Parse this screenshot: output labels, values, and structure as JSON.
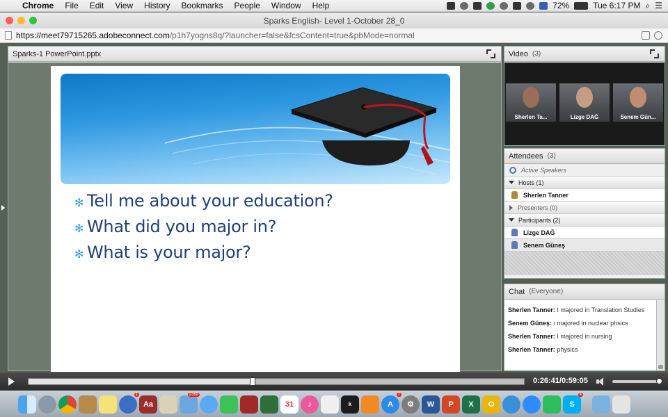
{
  "menubar": {
    "app": "Chrome",
    "items": [
      "File",
      "Edit",
      "View",
      "History",
      "Bookmarks",
      "People",
      "Window",
      "Help"
    ],
    "battery": "72%",
    "clock": "Tue 6:17 PM"
  },
  "browser": {
    "title": "Sparks English- Level 1-October 28_0",
    "url_host": "https://meet79715265.adobeconnect.com",
    "url_rest": "/p1h7yogns8q/?launcher=false&fcsContent=true&pbMode=normal"
  },
  "share": {
    "title": "Sparks-1 PowerPoint.pptx",
    "bullets": [
      "Tell me about your education?",
      "What did you major in?",
      "What is your major?"
    ]
  },
  "video": {
    "title": "Video",
    "count": "(3)",
    "feeds": [
      {
        "name": "Sherlen Ta..."
      },
      {
        "name": "Lizge DAĞ"
      },
      {
        "name": "Senem Gün..."
      }
    ]
  },
  "attendees": {
    "title": "Attendees",
    "count": "(3)",
    "active_speakers": "Active Speakers",
    "hosts_label": "Hosts (1)",
    "hosts": [
      "Sherlen Tanner"
    ],
    "presenters_label": "Presenters (0)",
    "participants_label": "Participants (2)",
    "participants": [
      "Lizge DAĞ",
      "Senem Güneş"
    ]
  },
  "chat": {
    "title": "Chat",
    "scope": "(Everyone)",
    "messages": [
      {
        "sender": "Sherlen Tanner:",
        "text": " I majored in Translation Studies"
      },
      {
        "sender": "Senem Güneş:",
        "text": " ı majored in nuclear phsics"
      },
      {
        "sender": "Sherlen Tanner:",
        "text": " I majored in nursing"
      },
      {
        "sender": "Sherlen Tanner:",
        "text": " physics"
      }
    ]
  },
  "playback": {
    "timecode": "0:26:41/0:59:05",
    "progress": 0.452
  },
  "dock": {
    "badges": {
      "contacts": "1",
      "calendar_day": "31",
      "mail": "2360",
      "appstore": "7",
      "skype": "4"
    }
  },
  "colors": {
    "slide_text": "#1d3f7a",
    "bullet_star": "#3aa0d8",
    "banner_blue": "#1a84d3"
  }
}
